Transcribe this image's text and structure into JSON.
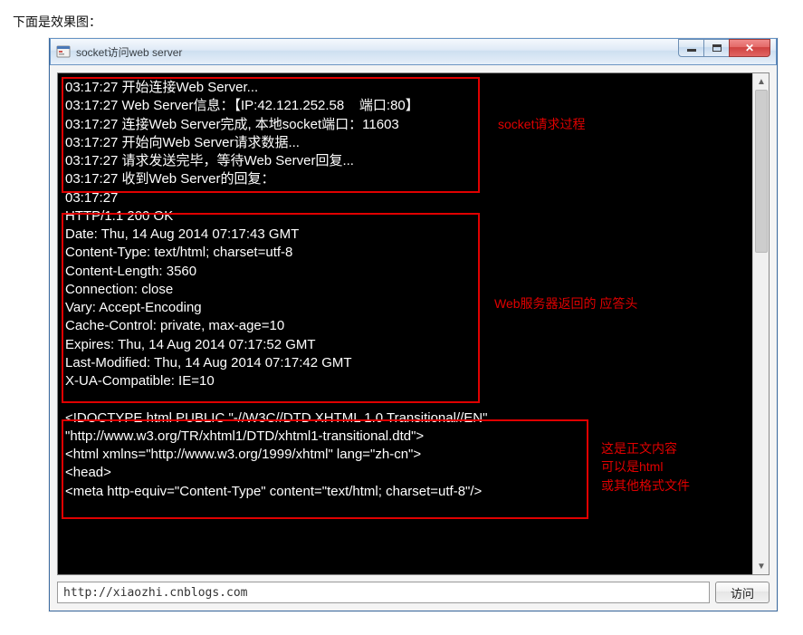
{
  "caption": "下面是效果图：",
  "window": {
    "title": "socket访问web server",
    "min_tooltip": "Minimize",
    "max_tooltip": "Maximize",
    "close_tooltip": "Close"
  },
  "console": {
    "section1": {
      "lines": [
        "03:17:27 开始连接Web Server...",
        "03:17:27 Web Server信息：【IP:42.121.252.58    端口:80】",
        "03:17:27 连接Web Server完成, 本地socket端口：11603",
        "03:17:27 开始向Web Server请求数据...",
        "03:17:27 请求发送完毕，等待Web Server回复...",
        "03:17:27 收到Web Server的回复："
      ]
    },
    "mid_line": "03:17:27",
    "section2": {
      "lines": [
        "HTTP/1.1 200 OK",
        "Date: Thu, 14 Aug 2014 07:17:43 GMT",
        "Content-Type: text/html; charset=utf-8",
        "Content-Length: 3560",
        "Connection: close",
        "Vary: Accept-Encoding",
        "Cache-Control: private, max-age=10",
        "Expires: Thu, 14 Aug 2014 07:17:52 GMT",
        "Last-Modified: Thu, 14 Aug 2014 07:17:42 GMT",
        "X-UA-Compatible: IE=10"
      ]
    },
    "section3": {
      "lines": [
        "<!DOCTYPE html PUBLIC \"-//W3C//DTD XHTML 1.0 Transitional//EN\"",
        "\"http://www.w3.org/TR/xhtml1/DTD/xhtml1-transitional.dtd\">",
        "<html xmlns=\"http://www.w3.org/1999/xhtml\" lang=\"zh-cn\">",
        "<head>",
        "<meta http-equiv=\"Content-Type\" content=\"text/html; charset=utf-8\"/>"
      ]
    }
  },
  "annotations": {
    "a1": "socket请求过程",
    "a2": "Web服务器返回的 应答头",
    "a3": "这是正文内容\n可以是html\n或其他格式文件"
  },
  "bottom": {
    "url_value": "http://xiaozhi.cnblogs.com",
    "visit_label": "访问"
  }
}
